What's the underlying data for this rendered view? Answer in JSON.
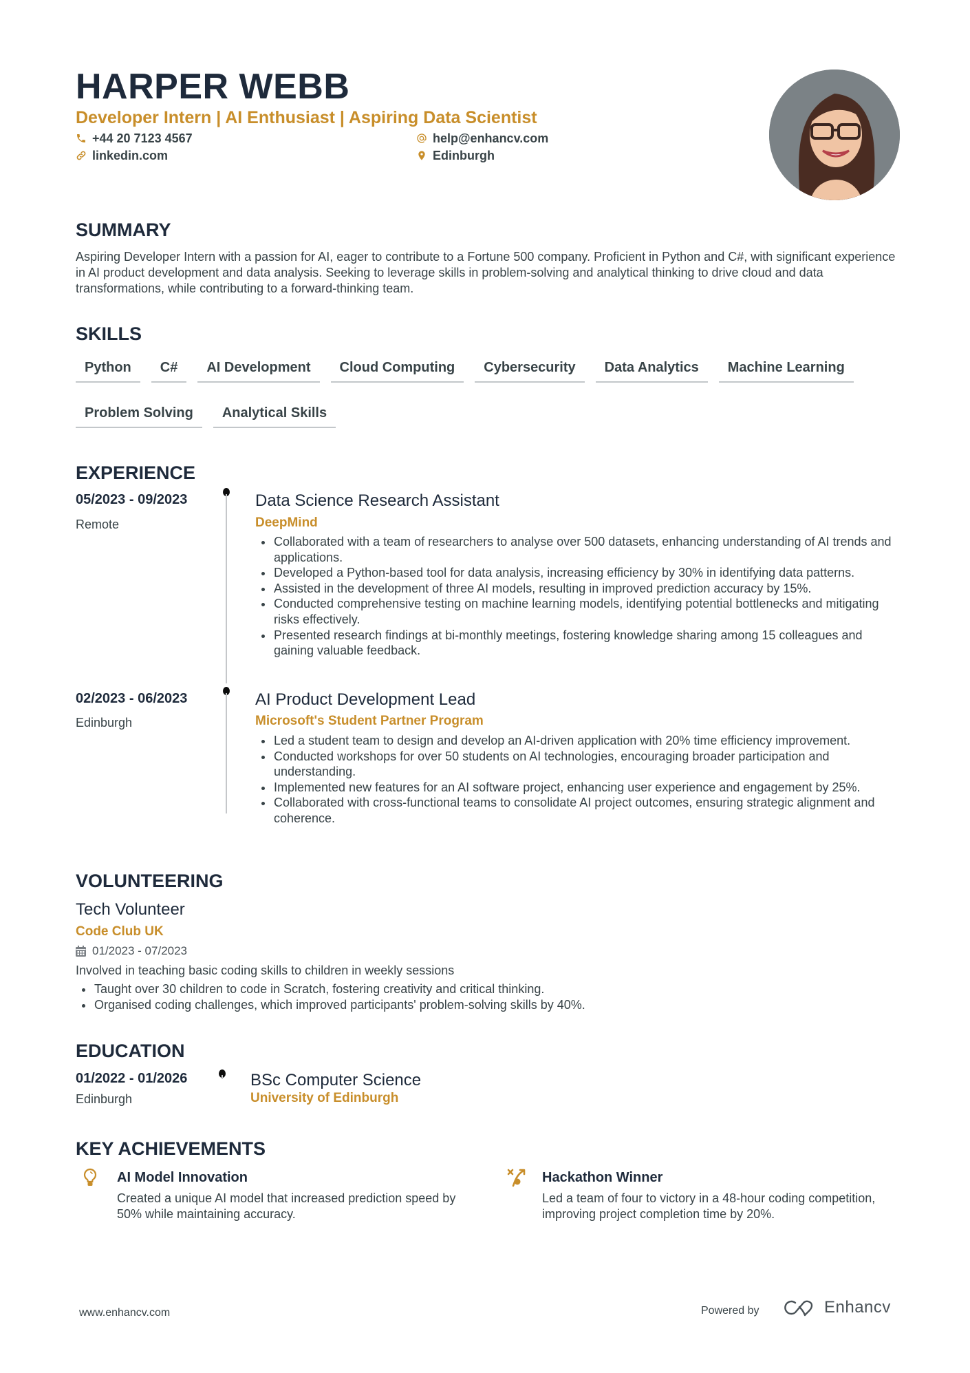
{
  "header": {
    "name": "HARPER WEBB",
    "headline": "Developer Intern | AI Enthusiast | Aspiring Data Scientist",
    "contacts": {
      "phone": {
        "icon": "phone-icon",
        "text": "+44 20 7123 4567"
      },
      "email": {
        "icon": "at-icon",
        "text": "help@enhancv.com"
      },
      "link": {
        "icon": "link-icon",
        "text": "linkedin.com"
      },
      "location": {
        "icon": "map-pin-icon",
        "text": "Edinburgh"
      }
    },
    "photo_alt": "Profile photo"
  },
  "colors": {
    "accent": "#c88e2a",
    "heading": "#1e2a3b",
    "text": "#384347",
    "timeline": "#c5c7ca"
  },
  "summary": {
    "title": "SUMMARY",
    "text": "Aspiring Developer Intern with a passion for AI, eager to contribute to a Fortune 500 company. Proficient in Python and C#, with significant experience in AI product development and data analysis. Seeking to leverage skills in problem-solving and analytical thinking to drive cloud and data transformations, while contributing to a forward-thinking team."
  },
  "skills": {
    "title": "SKILLS",
    "items": [
      "Python",
      "C#",
      "AI Development",
      "Cloud Computing",
      "Cybersecurity",
      "Data Analytics",
      "Machine Learning",
      "Problem Solving",
      "Analytical Skills"
    ]
  },
  "experience": {
    "title": "EXPERIENCE",
    "items": [
      {
        "dates": "05/2023 - 09/2023",
        "location": "Remote",
        "role": "Data Science Research Assistant",
        "company": "DeepMind",
        "bullets": [
          "Collaborated with a team of researchers to analyse over 500 datasets, enhancing understanding of AI trends and applications.",
          "Developed a Python-based tool for data analysis, increasing efficiency by 30% in identifying data patterns.",
          "Assisted in the development of three AI models, resulting in improved prediction accuracy by 15%.",
          "Conducted comprehensive testing on machine learning models, identifying potential bottlenecks and mitigating risks effectively.",
          "Presented research findings at bi-monthly meetings, fostering knowledge sharing among 15 colleagues and gaining valuable feedback."
        ]
      },
      {
        "dates": "02/2023 - 06/2023",
        "location": "Edinburgh",
        "role": "AI Product Development Lead",
        "company": "Microsoft's Student Partner Program",
        "bullets": [
          "Led a student team to design and develop an AI-driven application with 20% time efficiency improvement.",
          "Conducted workshops for over 50 students on AI technologies, encouraging broader participation and understanding.",
          "Implemented new features for an AI software project, enhancing user experience and engagement by 25%.",
          "Collaborated with cross-functional teams to consolidate AI project outcomes, ensuring strategic alignment and coherence."
        ]
      }
    ]
  },
  "volunteering": {
    "title": "VOLUNTEERING",
    "role": "Tech Volunteer",
    "organization": "Code Club UK",
    "dates": "01/2023 - 07/2023",
    "date_icon": "calendar-icon",
    "description": "Involved in teaching basic coding skills to children in weekly sessions",
    "bullets": [
      "Taught over 30 children to code in Scratch, fostering creativity and critical thinking.",
      "Organised coding challenges, which improved participants' problem-solving skills by 40%."
    ]
  },
  "education": {
    "title": "EDUCATION",
    "dates": "01/2022 - 01/2026",
    "location": "Edinburgh",
    "degree": "BSc Computer Science",
    "school": "University of Edinburgh"
  },
  "achievements": {
    "title": "KEY ACHIEVEMENTS",
    "items": [
      {
        "icon": "lightbulb-icon",
        "title": "AI Model Innovation",
        "description": "Created a unique AI model that increased prediction speed by 50% while maintaining accuracy."
      },
      {
        "icon": "strategy-icon",
        "title": "Hackathon Winner",
        "description": "Led a team of four to victory in a 48-hour coding competition, improving project completion time by 20%."
      }
    ]
  },
  "footer": {
    "url": "www.enhancv.com",
    "powered_by": "Powered by",
    "brand": "Enhancv"
  }
}
